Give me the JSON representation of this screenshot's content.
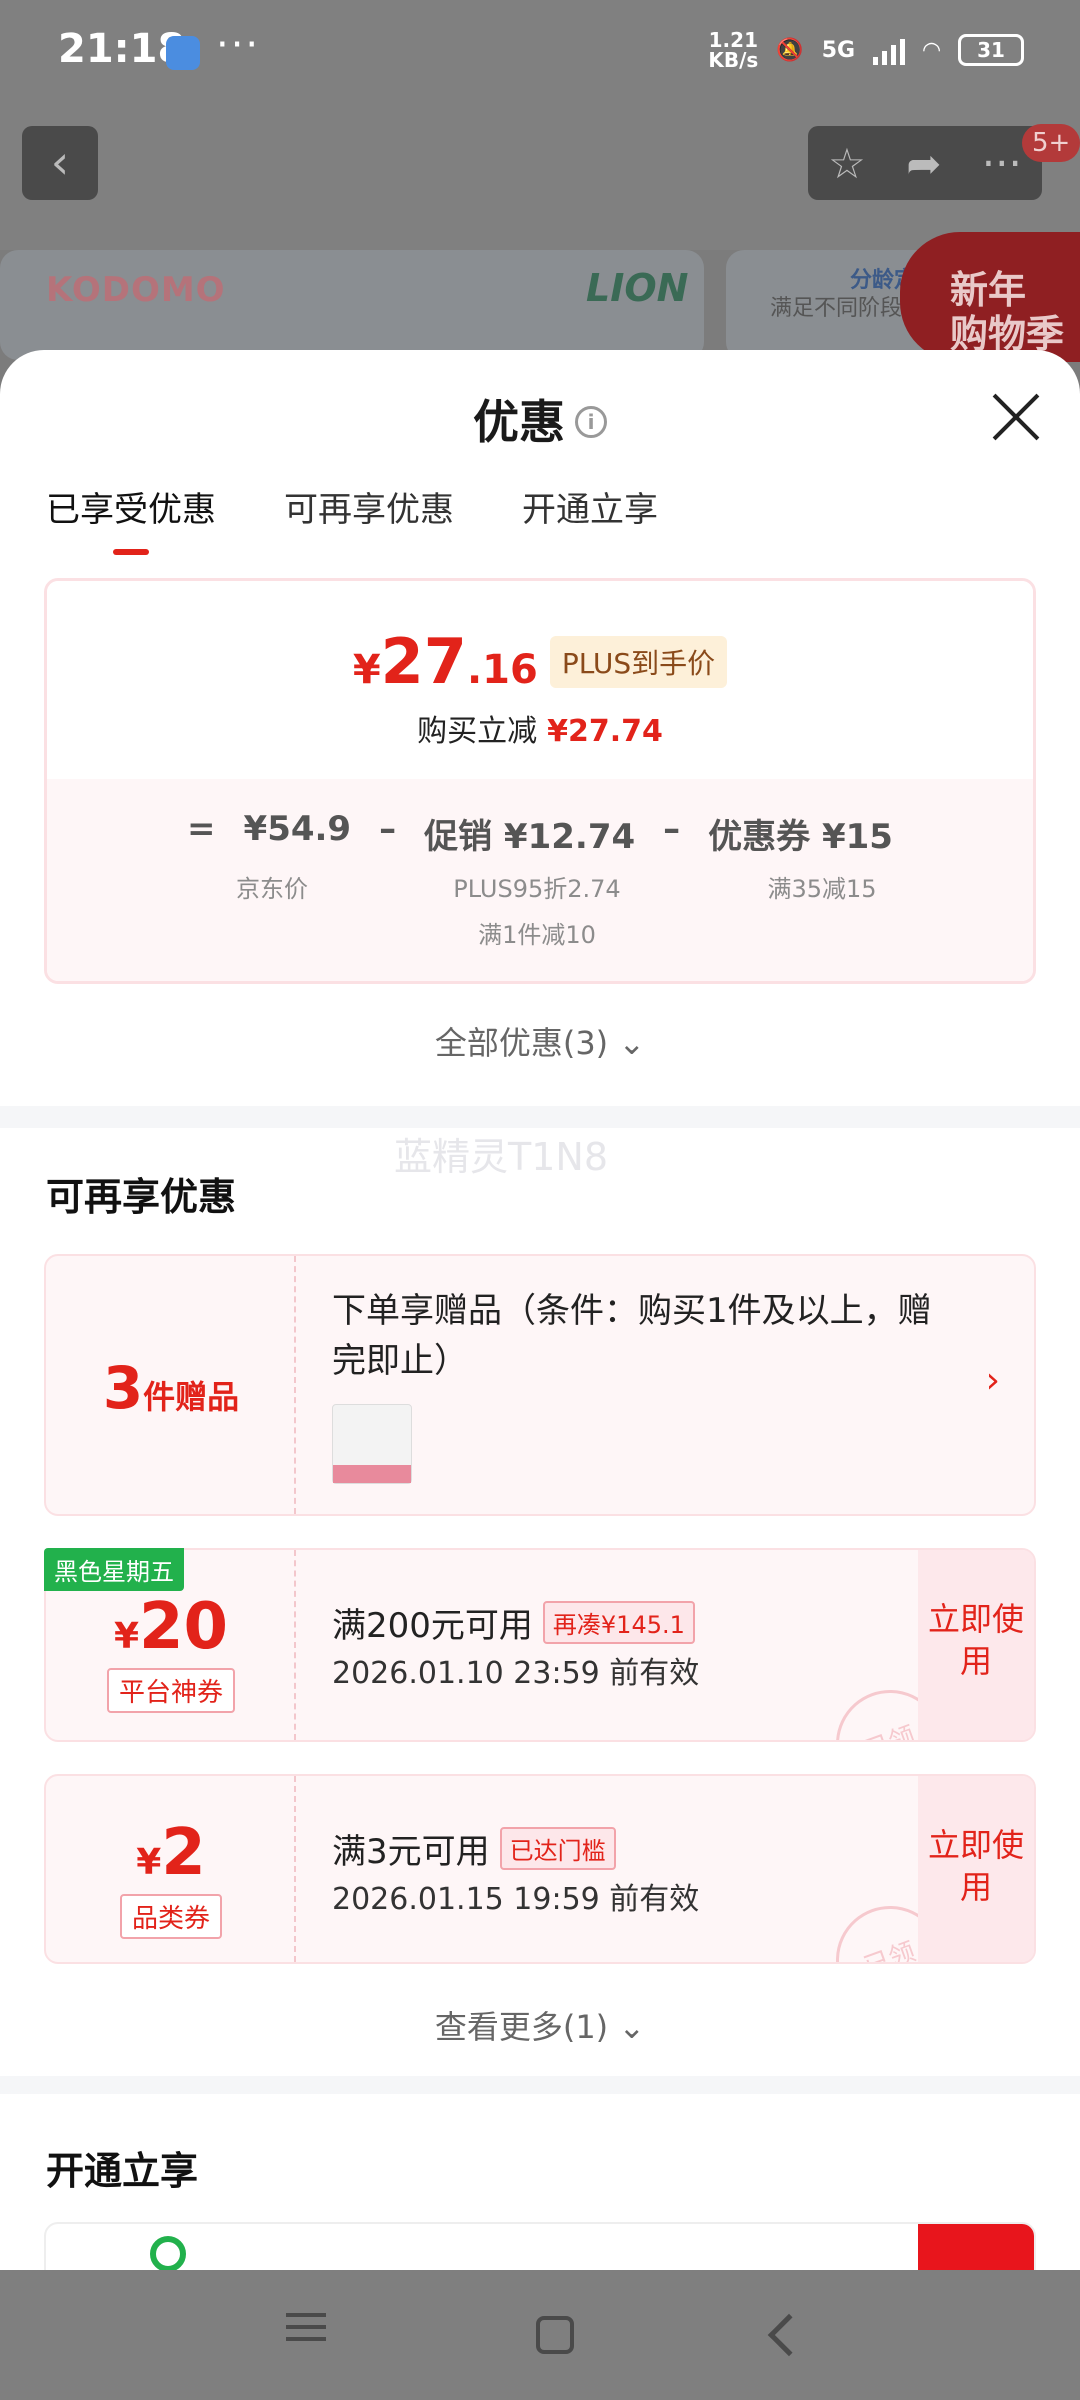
{
  "status_bar": {
    "time": "21:18",
    "speed_value": "1.21",
    "speed_unit": "KB/s",
    "network": "5G",
    "battery": "31"
  },
  "background": {
    "badge": "5+",
    "banner_brand_left": "KODOMO",
    "banner_brand_right": "LION",
    "banner_side_title": "分龄定",
    "banner_side_sub": "满足不同阶段",
    "new_year_line1": "新年",
    "new_year_line2": "购物季"
  },
  "sheet": {
    "title": "优惠",
    "tabs": [
      {
        "label": "已享受优惠",
        "active": true
      },
      {
        "label": "可再享优惠",
        "active": false
      },
      {
        "label": "开通立享",
        "active": false
      }
    ],
    "summary": {
      "currency": "¥",
      "price_int": "27",
      "price_dec": ".16",
      "price_tag": "PLUS到手价",
      "reduce_label": "购买立减",
      "reduce_value": "¥27.74",
      "calc": {
        "eq": "=",
        "base": "¥54.9",
        "minus1": "–",
        "promo": "促销 ¥12.74",
        "minus2": "–",
        "coupon": "优惠券 ¥15"
      },
      "sub_base": "京东价",
      "sub_promo_1": "PLUS95折2.74",
      "sub_promo_2": "满1件减10",
      "sub_coupon": "满35减15"
    },
    "all_offers": "全部优惠(3) ⌄",
    "watermark": "蓝精灵T1N8",
    "section_more": "可再享优惠",
    "gift": {
      "num": "3",
      "label": "件赠品",
      "text": "下单享赠品（条件：购买1件及以上，赠完即止）",
      "arrow": "›"
    },
    "coupons": [
      {
        "ribbon": "黑色星期五",
        "currency": "¥",
        "amount": "20",
        "type": "平台神券",
        "condition": "满200元可用",
        "cond_tag": "再凑¥145.1",
        "date": "2026.01.10 23:59 前有效",
        "button": "立即使用",
        "stamp": "已领"
      },
      {
        "currency": "¥",
        "amount": "2",
        "type": "品类券",
        "condition": "满3元可用",
        "cond_tag": "已达门槛",
        "date": "2026.01.15 19:59 前有效",
        "button": "立即使用",
        "stamp": "已领"
      }
    ],
    "see_more": "查看更多(1) ⌄",
    "section_open": "开通立享"
  }
}
